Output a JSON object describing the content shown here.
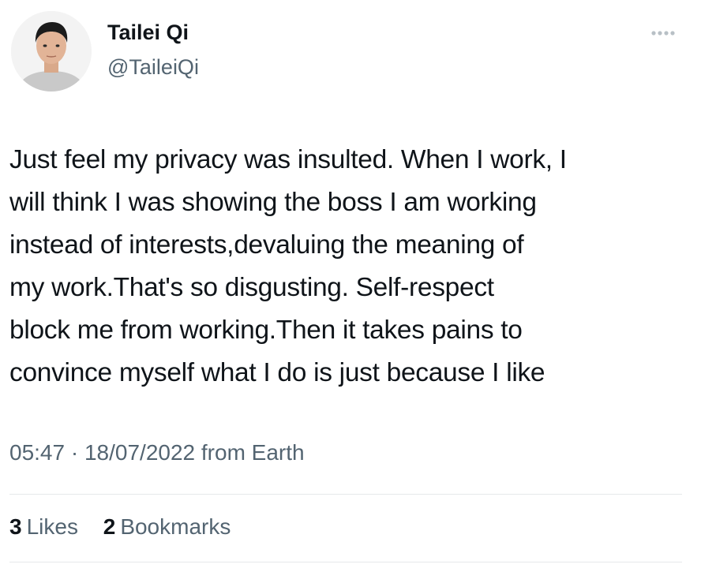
{
  "author": {
    "display_name": "Tailei Qi",
    "handle": "@TaileiQi",
    "avatar_icon": "profile-photo"
  },
  "more_icon": "ellipsis-icon",
  "tweet": {
    "lines": [
      "Just feel my privacy was insulted.  When I work, I",
      "will think I was showing the boss I am working",
      "instead of interests,devaluing the meaning of",
      "my work.That's so disgusting. Self-respect",
      "block me from working.Then it takes pains to",
      "convince myself what I do is just because I like"
    ]
  },
  "meta": {
    "time": "05:47",
    "separator": "·",
    "date": "18/07/2022",
    "source": "from Earth"
  },
  "stats": {
    "likes_count": "3",
    "likes_label": "Likes",
    "bookmarks_count": "2",
    "bookmarks_label": "Bookmarks"
  },
  "colors": {
    "text_primary": "#0f1419",
    "text_secondary": "#536471",
    "divider": "#e6e8ea"
  }
}
